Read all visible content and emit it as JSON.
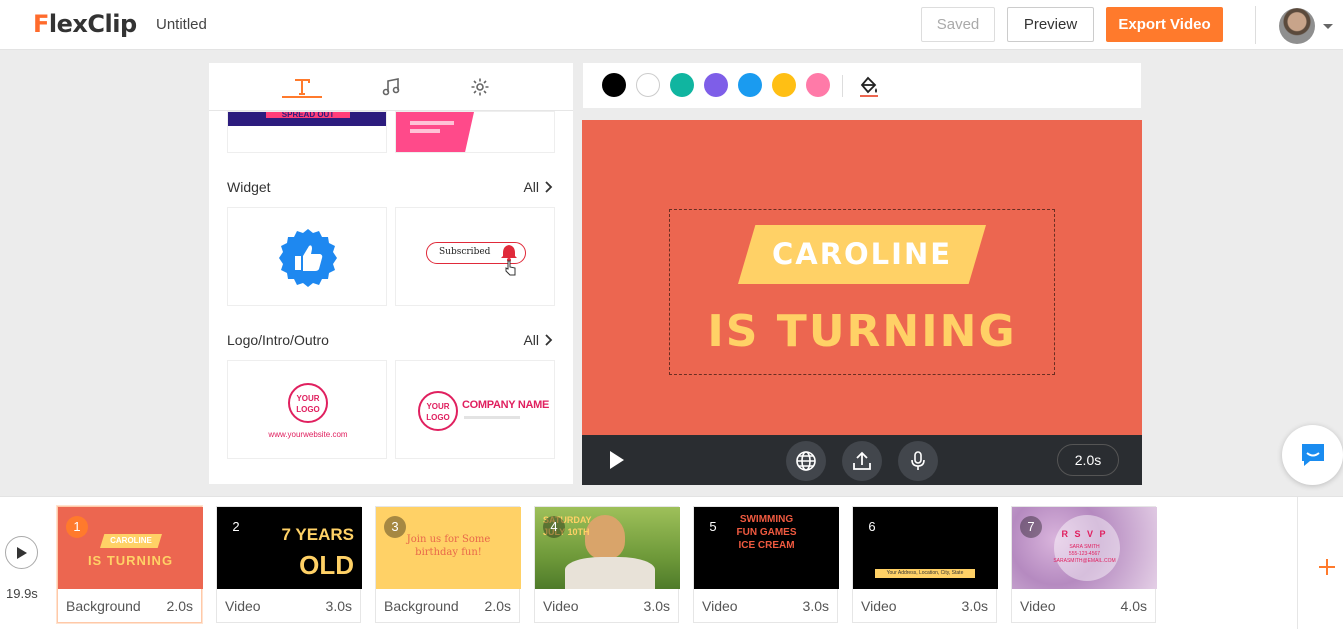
{
  "header": {
    "logo": "FlexClip",
    "project_title": "Untitled",
    "saved_label": "Saved",
    "preview_label": "Preview",
    "export_label": "Export Video"
  },
  "left_panel": {
    "tabs": [
      "text-icon",
      "music-icon",
      "settings-icon"
    ],
    "spread_label": "SPREAD OUT",
    "widget_title": "Widget",
    "widget_all": "All",
    "subscribed_label": "Subscribed",
    "logo_title": "Logo/Intro/Outro",
    "logo_all": "All",
    "your_logo": "YOUR LOGO",
    "website": "www.yourwebsite.com",
    "company_name": "COMPANY NAME"
  },
  "colors": [
    "#000000",
    "#ffffff",
    "#10b5a0",
    "#7e5ee8",
    "#1a9bf0",
    "#ffbf14",
    "#ff7aa8"
  ],
  "canvas": {
    "background": "#ec6650",
    "banner_text": "CAROLINE",
    "main_text": "IS TURNING",
    "duration": "2.0s"
  },
  "timeline": {
    "total": "19.9s",
    "scenes": [
      {
        "num": "1",
        "type": "Background",
        "dur": "2.0s",
        "line1": "CAROLINE",
        "line2": "IS TURNING"
      },
      {
        "num": "2",
        "type": "Video",
        "dur": "3.0s",
        "line1": "7 YEARS",
        "line2": "OLD"
      },
      {
        "num": "3",
        "type": "Background",
        "dur": "2.0s",
        "line1": "Join us for Some",
        "line2": "birthday fun!"
      },
      {
        "num": "4",
        "type": "Video",
        "dur": "3.0s",
        "line1": "SATURDAY",
        "line2": "JULY 10TH"
      },
      {
        "num": "5",
        "type": "Video",
        "dur": "3.0s",
        "line1": "SWIMMING",
        "line2": "FUN GAMES",
        "line3": "ICE CREAM"
      },
      {
        "num": "6",
        "type": "Video",
        "dur": "3.0s",
        "line1": "Your Address, Location, City, State"
      },
      {
        "num": "7",
        "type": "Video",
        "dur": "4.0s",
        "line1": "R S V P",
        "line2": "SARA SMITH",
        "line3": "555-123-4567",
        "line4": "SARASMITH@EMAIL.COM"
      }
    ]
  }
}
